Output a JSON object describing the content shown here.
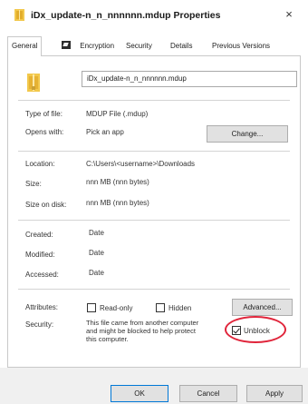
{
  "window": {
    "title": "iDx_update-n_n_nnnnnn.mdup Properties",
    "close_glyph": "×"
  },
  "tabs": [
    {
      "label": "General",
      "active": true
    },
    {
      "label": "Encryption",
      "active": false,
      "icon": "encryption-icon"
    },
    {
      "label": "Security",
      "active": false
    },
    {
      "label": "Details",
      "active": false
    },
    {
      "label": "Previous Versions",
      "active": false
    }
  ],
  "file": {
    "name": "iDx_update-n_n_nnnnnn.mdup",
    "icon": "file-icon"
  },
  "info": {
    "type_label": "Type of file:",
    "type_value": "MDUP File (.mdup)",
    "opens_label": "Opens with:",
    "opens_value": "Pick an app",
    "change_label": "Change...",
    "location_label": "Location:",
    "location_value": "C:\\Users\\<username>\\Downloads",
    "size_label": "Size:",
    "size_value": "nnn MB (nnn bytes)",
    "size_disk_label": "Size on disk:",
    "size_disk_value": "nnn MB (nnn bytes)",
    "created_label": "Created:",
    "created_value": "Date",
    "modified_label": "Modified:",
    "modified_value": "Date",
    "accessed_label": "Accessed:",
    "accessed_value": "Date"
  },
  "attributes": {
    "label": "Attributes:",
    "readonly_label": "Read-only",
    "readonly_checked": false,
    "hidden_label": "Hidden",
    "hidden_checked": false,
    "advanced_label": "Advanced..."
  },
  "security": {
    "label": "Security:",
    "lines": [
      "This file came from another computer",
      "and might be blocked to help protect",
      "this computer."
    ],
    "unblock_label": "Unblock",
    "unblock_checked": true,
    "highlight_color": "#e0243a"
  },
  "footer": {
    "ok_label": "OK",
    "cancel_label": "Cancel",
    "apply_label": "Apply"
  },
  "colors": {
    "accent": "#0078d7",
    "folder_yellow": "#f2c84b"
  }
}
